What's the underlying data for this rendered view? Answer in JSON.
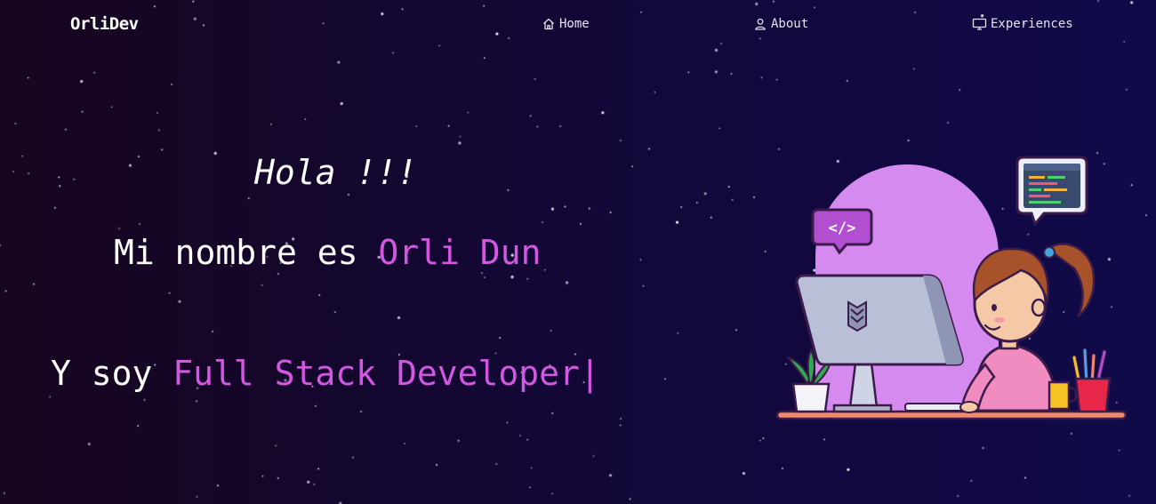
{
  "header": {
    "brand": "OrliDev",
    "nav": [
      {
        "label": "Home",
        "icon": "home-icon"
      },
      {
        "label": "About",
        "icon": "user-icon"
      },
      {
        "label": "Experiences",
        "icon": "monitor-icon"
      }
    ]
  },
  "hero": {
    "greeting": "Hola !!!",
    "name_prefix": "Mi nombre es ",
    "name": "Orli Dun",
    "role_prefix": "Y soy ",
    "role": "Full Stack Developer",
    "cursor": "|"
  },
  "illustration": {
    "code_symbol": "</>"
  },
  "colors": {
    "accent": "#d457e3",
    "background_start": "#17061f",
    "background_end": "#100a4a",
    "blob": "#d58af0"
  }
}
